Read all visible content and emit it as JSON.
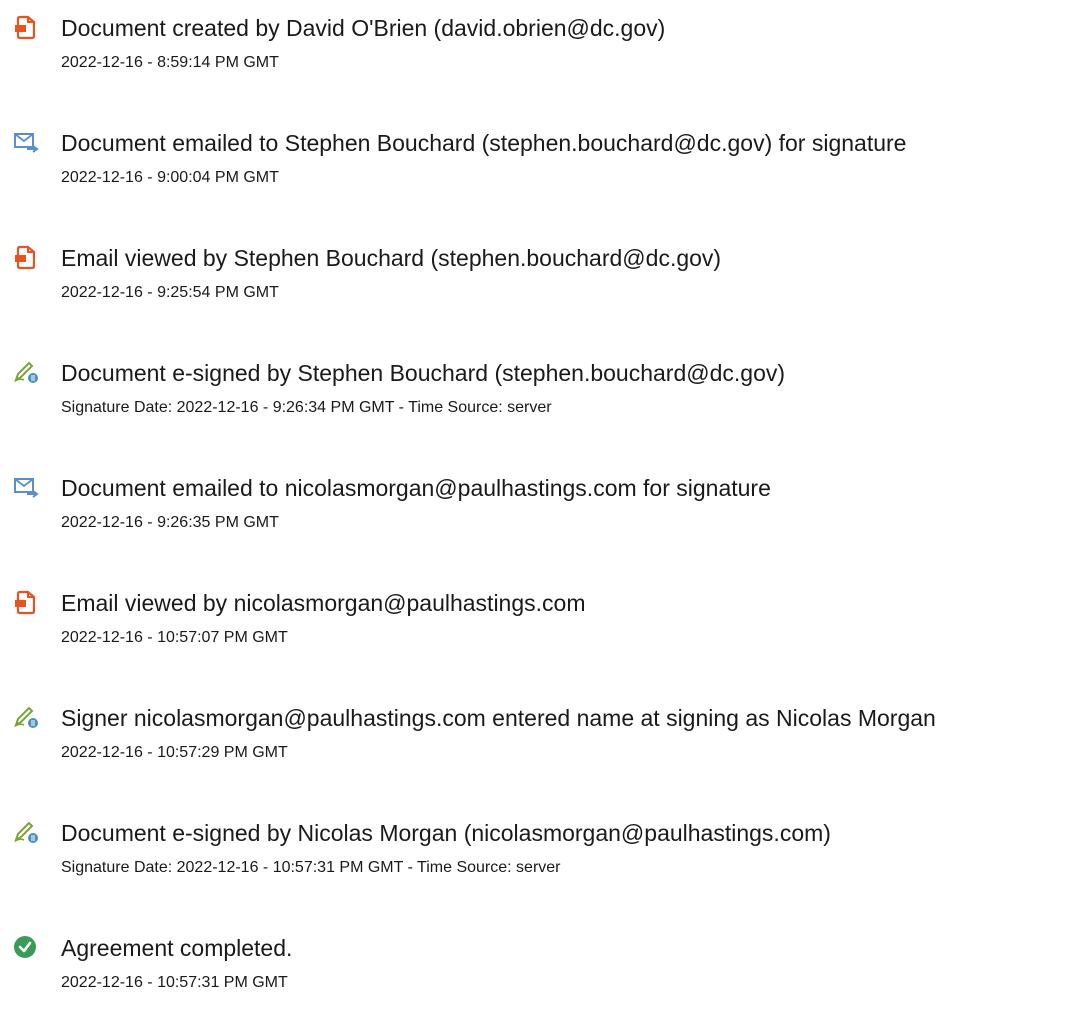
{
  "colors": {
    "doc_icon": "#e8531f",
    "mail_icon": "#5b8fc7",
    "sign_icon_pen": "#79a33a",
    "sign_icon_badge": "#4a90b8",
    "complete_icon": "#3a9a57"
  },
  "events": [
    {
      "icon": "document-icon",
      "title": "Document created by David O'Brien (david.obrien@dc.gov)",
      "detail": "2022-12-16 - 8:59:14 PM GMT"
    },
    {
      "icon": "email-icon",
      "title": "Document emailed to Stephen Bouchard (stephen.bouchard@dc.gov) for signature",
      "detail": "2022-12-16 - 9:00:04 PM GMT"
    },
    {
      "icon": "document-icon",
      "title": "Email viewed by Stephen Bouchard (stephen.bouchard@dc.gov)",
      "detail": "2022-12-16 - 9:25:54 PM GMT"
    },
    {
      "icon": "esign-icon",
      "title": "Document e-signed by Stephen Bouchard (stephen.bouchard@dc.gov)",
      "detail": "Signature Date: 2022-12-16 - 9:26:34 PM GMT - Time Source: server"
    },
    {
      "icon": "email-icon",
      "title": "Document emailed to nicolasmorgan@paulhastings.com for signature",
      "detail": "2022-12-16 - 9:26:35 PM GMT"
    },
    {
      "icon": "document-icon",
      "title": "Email viewed by nicolasmorgan@paulhastings.com",
      "detail": "2022-12-16 - 10:57:07 PM GMT"
    },
    {
      "icon": "esign-icon",
      "title": "Signer nicolasmorgan@paulhastings.com entered name at signing as Nicolas Morgan",
      "detail": "2022-12-16 - 10:57:29 PM GMT"
    },
    {
      "icon": "esign-icon",
      "title": "Document e-signed by Nicolas Morgan (nicolasmorgan@paulhastings.com)",
      "detail": "Signature Date: 2022-12-16 - 10:57:31 PM GMT - Time Source: server"
    },
    {
      "icon": "checkmark-circle-icon",
      "title": "Agreement completed.",
      "detail": "2022-12-16 - 10:57:31 PM GMT"
    }
  ]
}
